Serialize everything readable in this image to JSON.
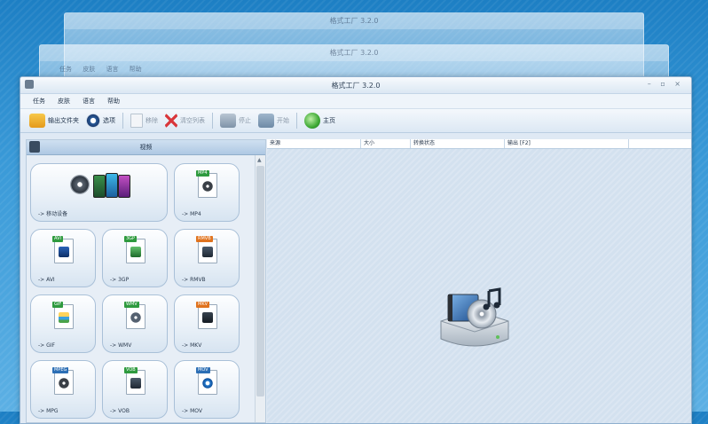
{
  "window": {
    "title": "格式工厂 3.2.0",
    "controls": "– ▫ ×"
  },
  "ghost_windows": [
    {
      "title": "格式工厂 3.2.0"
    },
    {
      "title": "格式工厂 3.2.0",
      "menu": "任务 皮肤 语言 帮助"
    }
  ],
  "menu": [
    "任务",
    "皮肤",
    "语言",
    "帮助"
  ],
  "toolbar": {
    "output_folder": "输出文件夹",
    "options": "选项",
    "remove": "移除",
    "clear_list": "清空列表",
    "stop": "停止",
    "start": "开始",
    "homepage": "主页"
  },
  "category": {
    "title": "视频"
  },
  "formats": [
    {
      "label": "-> 移动设备",
      "tag": ""
    },
    {
      "label": "-> MP4",
      "tag": "MP4"
    },
    {
      "label": "-> AVI",
      "tag": "AVI"
    },
    {
      "label": "-> 3GP",
      "tag": "3GP"
    },
    {
      "label": "-> RMVB",
      "tag": "RMVB"
    },
    {
      "label": "-> GIF",
      "tag": "GIF"
    },
    {
      "label": "-> WMV",
      "tag": "WMV"
    },
    {
      "label": "-> MKV",
      "tag": "MKV"
    },
    {
      "label": "-> MPG",
      "tag": "MPEG"
    },
    {
      "label": "-> VOB",
      "tag": "VOB"
    },
    {
      "label": "-> MOV",
      "tag": "MOV"
    }
  ],
  "task_table": {
    "columns": [
      "来源",
      "大小",
      "转换状态",
      "输出 [F2]"
    ]
  },
  "colors": {
    "accent": "#1d7fc4",
    "tag_green": "#2e9a3e",
    "tag_orange": "#e0731e",
    "tag_blue": "#2d6fb5"
  }
}
